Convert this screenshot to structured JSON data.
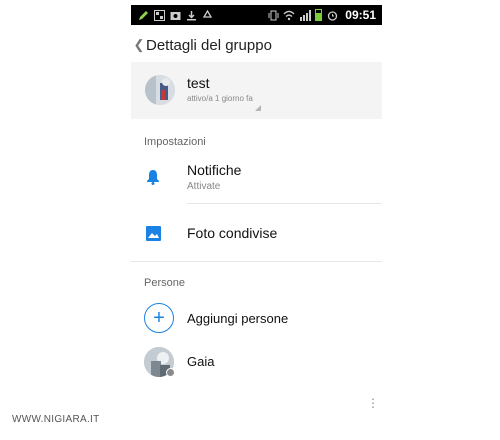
{
  "status_bar": {
    "time": "09:51",
    "icons": [
      "pencil-icon",
      "grid-icon",
      "camera-icon",
      "download-icon",
      "recycle-icon",
      "vibrate-icon",
      "wifi-icon",
      "signal-icon",
      "battery-icon",
      "alarm-icon"
    ]
  },
  "header": {
    "title": "Dettagli del gruppo",
    "back_glyph": "❮"
  },
  "group": {
    "name": "test",
    "status": "attivo/a 1 giorno fa"
  },
  "settings": {
    "section_label": "Impostazioni",
    "notifications": {
      "title": "Notifiche",
      "subtitle": "Attivate"
    },
    "shared_photos": {
      "title": "Foto condivise"
    }
  },
  "people": {
    "section_label": "Persone",
    "add_label": "Aggiungi persone",
    "members": [
      {
        "name": "Gaia"
      }
    ]
  },
  "watermark": "WWW.NIGIARA.IT",
  "colors": {
    "accent": "#1a82e2",
    "status_bar": "#000000",
    "card_bg": "#f4f4f4"
  }
}
